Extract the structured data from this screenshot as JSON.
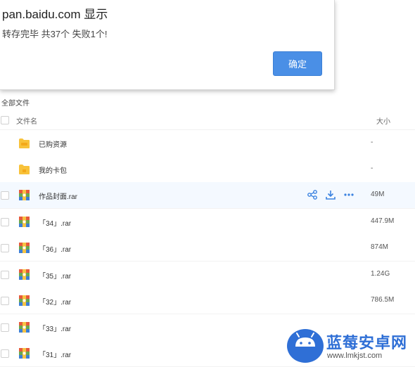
{
  "dialog": {
    "title": "pan.baidu.com 显示",
    "message": "转存完毕 共37个 失败1个!",
    "ok_label": "确定"
  },
  "breadcrumb": "全部文件",
  "header": {
    "name": "文件名",
    "size": "大小"
  },
  "files": [
    {
      "name": "已购资源",
      "size": "-",
      "icon": "folder-icon"
    },
    {
      "name": "我的卡包",
      "size": "-",
      "icon": "folder-icon"
    },
    {
      "name": "作品封面.rar",
      "size": "49M",
      "icon": "rar-archive-icon"
    },
    {
      "name": "「34」.rar",
      "size": "447.9M",
      "icon": "rar-archive-icon"
    },
    {
      "name": "「36」.rar",
      "size": "874M",
      "icon": "rar-archive-icon"
    },
    {
      "name": "「35」.rar",
      "size": "1.24G",
      "icon": "rar-archive-icon"
    },
    {
      "name": "「32」.rar",
      "size": "786.5M",
      "icon": "rar-archive-icon"
    },
    {
      "name": "「33」.rar",
      "size": "",
      "icon": "rar-archive-icon"
    },
    {
      "name": "「31」.rar",
      "size": "",
      "icon": "rar-archive-icon"
    }
  ],
  "row_actions": [
    "share-icon",
    "download-icon",
    "more-icon"
  ],
  "watermark": {
    "text": "蓝莓安卓网",
    "url": "www.lmkjst.com"
  },
  "colors": {
    "accent": "#4a8fe6",
    "link": "#3b6fb8",
    "hover_row": "#f4f9ff",
    "watermark": "#2f6fd6"
  }
}
